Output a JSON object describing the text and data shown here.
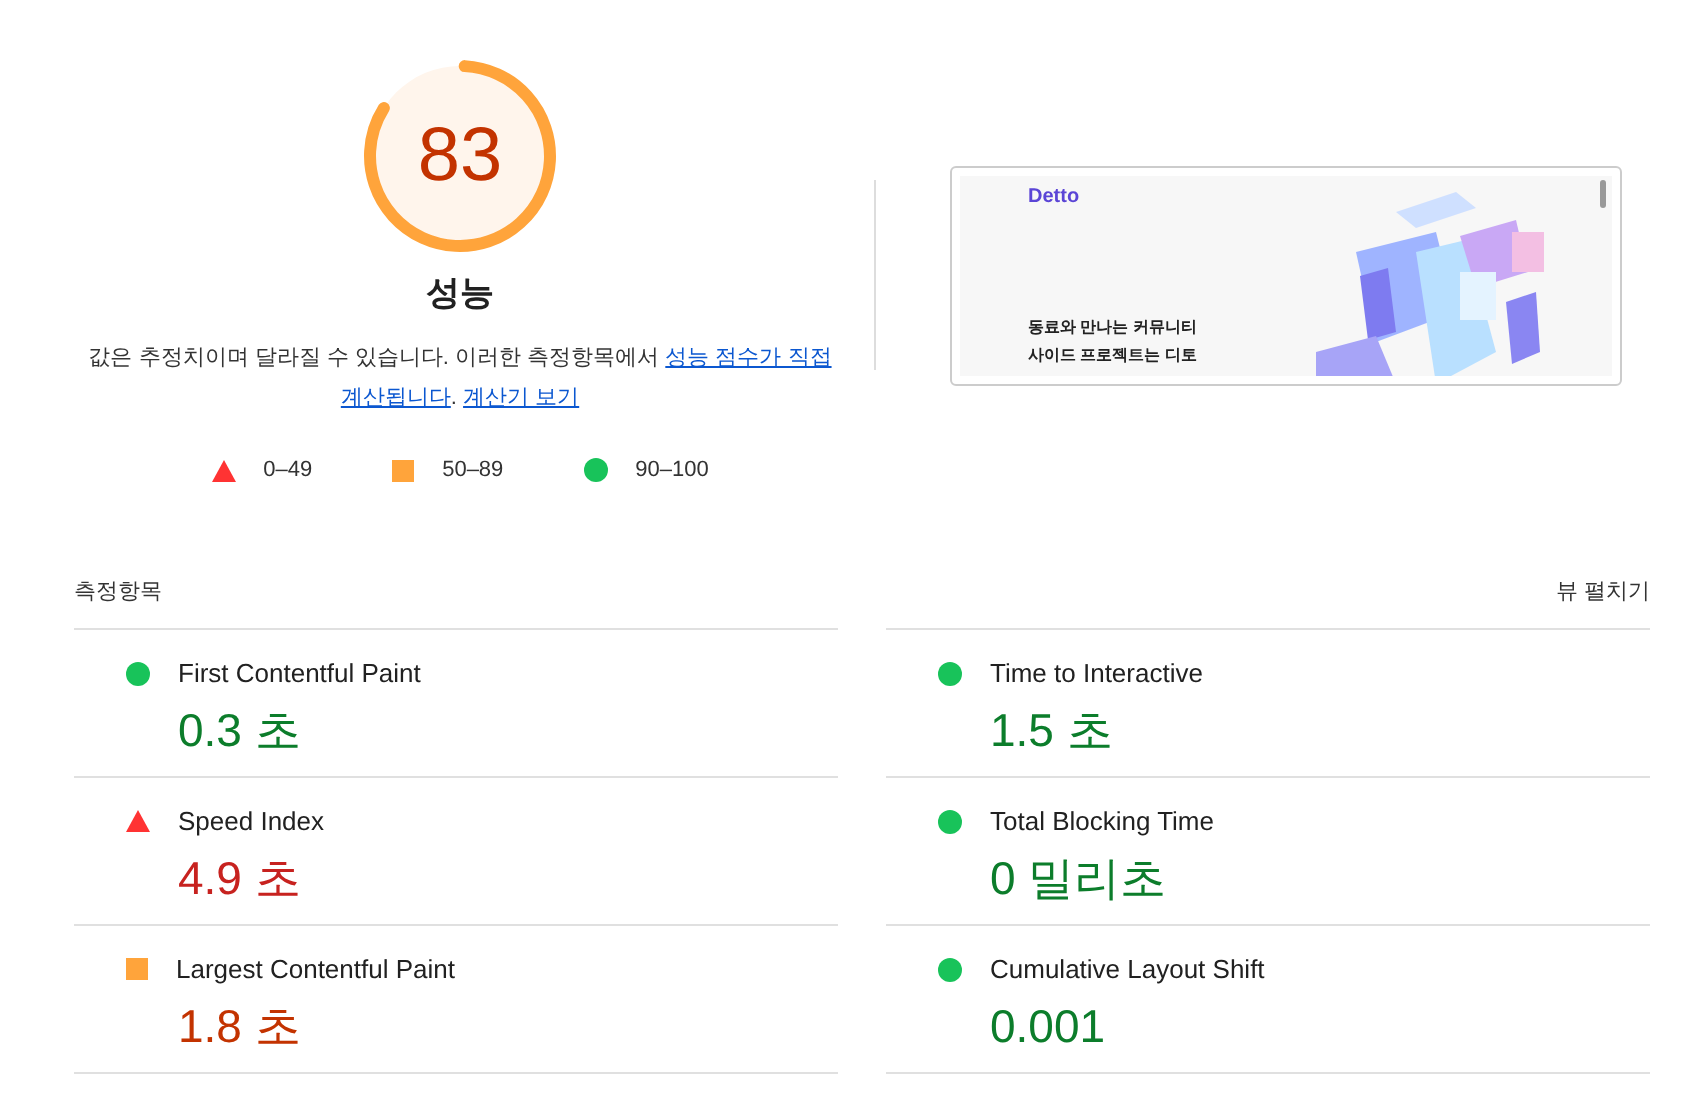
{
  "gauge": {
    "score": "83",
    "level": 0.83,
    "kind": "average",
    "title": "성능"
  },
  "description": {
    "text": "값은 추정치이며 달라질 수 있습니다. 이러한 측정항목에서 ",
    "link1": [
      "성능 점수가 직접",
      "계산됩니다"
    ],
    "sep": ". ",
    "link2": "계산기 보기"
  },
  "legend": [
    {
      "kind": "fail",
      "label": "0–49"
    },
    {
      "kind": "average",
      "label": "50–89"
    },
    {
      "kind": "pass",
      "label": "90–100"
    }
  ],
  "screenshot": {
    "logo": "Detto",
    "headline": [
      "동료와 만나는 커뮤니티",
      "사이드 프로젝트는 디토"
    ]
  },
  "metrics_header": {
    "title": "측정항목",
    "toggle": "뷰 펼치기"
  },
  "metrics": [
    {
      "kind": "pass",
      "name": "First Contentful Paint",
      "value": "0.3 초"
    },
    {
      "kind": "pass",
      "name": "Time to Interactive",
      "value": "1.5 초"
    },
    {
      "kind": "fail",
      "name": "Speed Index",
      "value": "4.9 초"
    },
    {
      "kind": "pass",
      "name": "Total Blocking Time",
      "value": "0 밀리초"
    },
    {
      "kind": "average",
      "name": "Largest Contentful Paint",
      "value": "1.8 초"
    },
    {
      "kind": "pass",
      "name": "Cumulative Layout Shift",
      "value": "0.001"
    }
  ]
}
